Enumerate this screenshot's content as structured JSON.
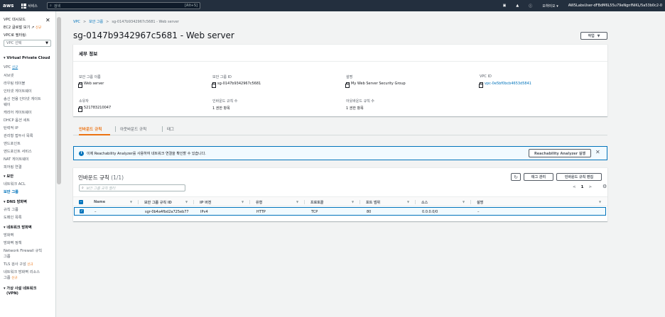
{
  "topbar": {
    "logo": "aws",
    "services": "서비스",
    "search_placeholder": "검색",
    "search_shortcut": "[Alt+S]",
    "region": "오하이오 ▾",
    "account": "AWSLabsUser-dFBdM6L55u79eNgnfNiKL/5a53b0c2-0"
  },
  "sidebar": {
    "dashboard": "VPC 대시보드",
    "ec2_global": "EC2 글로벌 보기",
    "new": "신규",
    "filter_label": "VPC로 필터링:",
    "filter_value": "VPC 선택",
    "section_vpc": "Virtual Private Cloud",
    "items": [
      "VPC",
      "서브넷",
      "라우팅 테이블",
      "인터넷 게이트웨이",
      "송신 전용 인터넷 게이트",
      "웨이",
      "캐리어 게이트웨이",
      "DHCP 옵션 세트",
      "탄력적 IP",
      "관리형 접두사 목록",
      "엔드포인트",
      "엔드포인트 서비스",
      "NAT 게이트웨이",
      "피어링 연결"
    ],
    "vpc_new": "신규",
    "section_security": "보안",
    "security_items": [
      "네트워크 ACL",
      "보안 그룹"
    ],
    "section_dns": "DNS 방화벽",
    "dns_items": [
      "규칙 그룹",
      "도메인 목록"
    ],
    "section_nfw": "네트워크 방화벽",
    "nfw_items": [
      "방화벽",
      "방화벽 정책",
      "Network Firewall 규칙",
      "그룹",
      "TLS 검사 구성",
      "네트워크 방화벽 리소스",
      "그룹"
    ],
    "section_vpn": "가상 사설 네트워크",
    "vpn_sub": "(VPN)"
  },
  "breadcrumb": {
    "vpc": "VPC",
    "sg": "보안 그룹",
    "current": "sg-0147b9342967c5681 - Web server"
  },
  "title": "sg-0147b9342967c5681 - Web server",
  "actions_label": "작업",
  "details": {
    "header": "세부 정보",
    "fields": [
      {
        "label": "보안 그룹 이름",
        "value": "Web server"
      },
      {
        "label": "보안 그룹 ID",
        "value": "sg-0147b9342967c5681"
      },
      {
        "label": "설명",
        "value": "My Web Server Security Group"
      },
      {
        "label": "VPC ID",
        "value": "vpc-0e5bf0bcb4653d5841"
      },
      {
        "label": "소유자",
        "value": "521783210047"
      },
      {
        "label": "인바운드 규칙 수",
        "value": "1 권한 항목"
      },
      {
        "label": "아웃바운드 규칙 수",
        "value": "1 권한 항목"
      }
    ]
  },
  "tabs": [
    "인바운드 규칙",
    "아웃바운드 규칙",
    "태그"
  ],
  "info_banner": {
    "text": "이제 Reachability Analyzer를 사용하여 네트워크 연결을 확인할 수 있습니다.",
    "button": "Reachability Analyzer 실행"
  },
  "rules": {
    "title": "인바운드 규칙",
    "count": "(1/1)",
    "manage_tags": "태그 관리",
    "edit_rules": "인바운드 규칙 편집",
    "search_placeholder": "보안 그룹 규칙 필터",
    "page": "1",
    "columns": [
      "Name",
      "보안 그룹 규칙 ID",
      "IP 버전",
      "유형",
      "프로토콜",
      "포트 범위",
      "소스",
      "설명"
    ],
    "rows": [
      [
        "–",
        "sgr-0b4a4fbd2a725eb77",
        "IPv4",
        "HTTP",
        "TCP",
        "80",
        "0.0.0.0/0",
        "–"
      ]
    ]
  }
}
